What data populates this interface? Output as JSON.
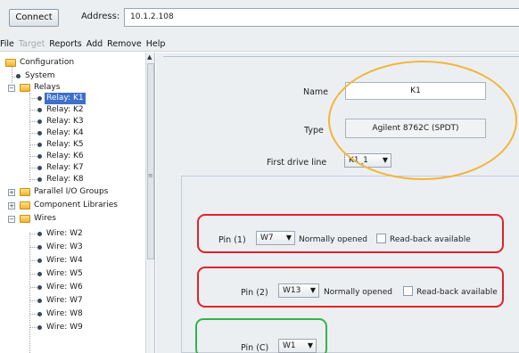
{
  "toolbar": {
    "connect_label": "Connect",
    "address_label": "Address:",
    "address_value": "10.1.2.108"
  },
  "menu": [
    "File",
    "Target",
    "Reports",
    "Add",
    "Remove",
    "Help"
  ],
  "tree": {
    "configuration": "Configuration",
    "system": "System",
    "relays": "Relays",
    "relay_items": [
      "Relay: K1",
      "Relay: K2",
      "Relay: K3",
      "Relay: K4",
      "Relay: K5",
      "Relay: K6",
      "Relay: K7",
      "Relay: K8"
    ],
    "parallel_io": "Parallel I/O Groups",
    "component_libraries": "Component Libraries",
    "wires": "Wires",
    "wire_items": [
      "Wire: W2",
      "Wire: W3",
      "Wire: W4",
      "Wire: W5",
      "Wire: W6",
      "Wire: W7",
      "Wire: W8",
      "Wire: W9"
    ]
  },
  "details": {
    "name_label": "Name",
    "name_value": "K1",
    "type_label": "Type",
    "type_value": "Agilent 8762C (SPDT)",
    "first_drive_label": "First drive line",
    "first_drive_value": "K1_1"
  },
  "pins": {
    "pin1_label": "Pin (1)",
    "pin1_value": "W7",
    "pin2_label": "Pin (2)",
    "pin2_value": "W13",
    "pinc_label": "Pin (C)",
    "pinc_value": "W1",
    "normally_opened": "Normally opened",
    "readback": "Read-back available"
  },
  "colors": {
    "annotation_ellipse": "#f2b53a",
    "annotation_red": "#e32129",
    "annotation_green": "#34b34a",
    "selection": "#3d6fcb"
  }
}
